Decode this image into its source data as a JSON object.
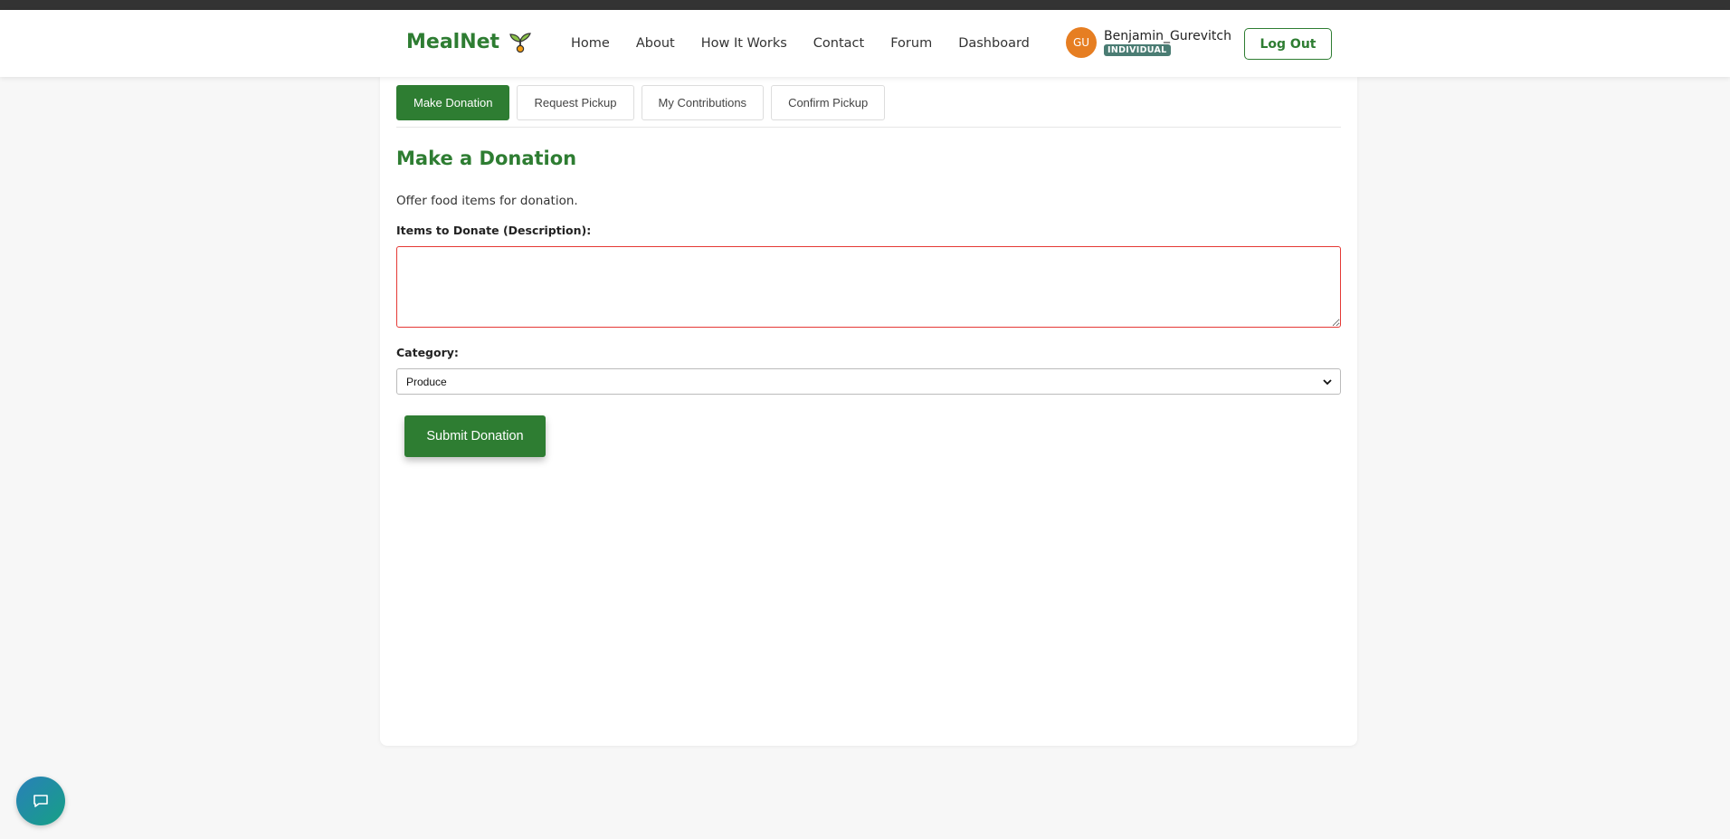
{
  "brand": {
    "name": "MealNet",
    "icon": "sprout-icon",
    "color": "#2e7d32"
  },
  "nav": [
    {
      "label": "Home"
    },
    {
      "label": "About"
    },
    {
      "label": "How It Works"
    },
    {
      "label": "Contact"
    },
    {
      "label": "Forum"
    },
    {
      "label": "Dashboard"
    }
  ],
  "user": {
    "initials": "GU",
    "name": "Benjamin_Gurevitch",
    "role": "INDIVIDUAL"
  },
  "logout_label": "Log Out",
  "tabs": [
    {
      "label": "Make Donation",
      "active": true
    },
    {
      "label": "Request Pickup",
      "active": false
    },
    {
      "label": "My Contributions",
      "active": false
    },
    {
      "label": "Confirm Pickup",
      "active": false
    }
  ],
  "form": {
    "title": "Make a Donation",
    "intro": "Offer food items for donation.",
    "items_label": "Items to Donate (Description):",
    "items_value": "",
    "category_label": "Category:",
    "category_value": "Produce",
    "submit_label": "Submit Donation"
  },
  "chat": {
    "icon": "chat-bubble-icon"
  }
}
